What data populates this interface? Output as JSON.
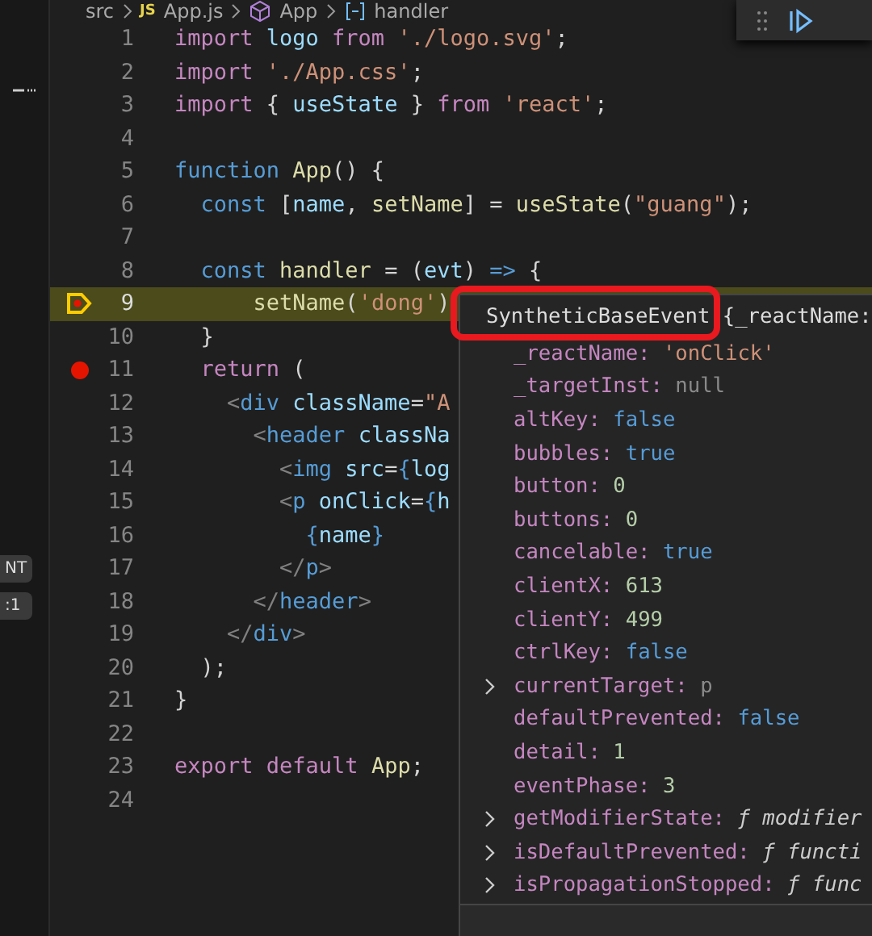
{
  "breadcrumbs": [
    {
      "label": "src",
      "kind": "folder"
    },
    {
      "label": "App.js",
      "kind": "file",
      "badge": "JS"
    },
    {
      "label": "App",
      "kind": "component"
    },
    {
      "label": "handler",
      "kind": "function"
    }
  ],
  "sidebar": {
    "badges": [
      "NT",
      ":1"
    ]
  },
  "lines": [
    {
      "number": "1",
      "highlighted": false,
      "tokens": [
        {
          "text": "import ",
          "kind": "keyword"
        },
        {
          "text": "logo ",
          "kind": "variable"
        },
        {
          "text": "from ",
          "kind": "keyword"
        },
        {
          "text": "'./logo.svg'",
          "kind": "string"
        },
        {
          "text": ";",
          "kind": "plain"
        }
      ]
    },
    {
      "number": "2",
      "highlighted": false,
      "tokens": [
        {
          "text": "import ",
          "kind": "keyword"
        },
        {
          "text": "'./App.css'",
          "kind": "string"
        },
        {
          "text": ";",
          "kind": "plain"
        }
      ]
    },
    {
      "number": "3",
      "highlighted": false,
      "tokens": [
        {
          "text": "import ",
          "kind": "keyword"
        },
        {
          "text": "{ ",
          "kind": "plain"
        },
        {
          "text": "useState",
          "kind": "variable"
        },
        {
          "text": " } ",
          "kind": "plain"
        },
        {
          "text": "from ",
          "kind": "keyword"
        },
        {
          "text": "'react'",
          "kind": "string"
        },
        {
          "text": ";",
          "kind": "plain"
        }
      ]
    },
    {
      "number": "4",
      "highlighted": false
    },
    {
      "number": "5",
      "highlighted": false,
      "tokens": [
        {
          "text": "function ",
          "kind": "storage"
        },
        {
          "text": "App",
          "kind": "function"
        },
        {
          "text": "() {",
          "kind": "plain"
        }
      ]
    },
    {
      "number": "6",
      "highlighted": false,
      "tokens": [
        {
          "text": "  const ",
          "kind": "storage"
        },
        {
          "text": "[",
          "kind": "plain"
        },
        {
          "text": "name",
          "kind": "variable"
        },
        {
          "text": ", ",
          "kind": "plain"
        },
        {
          "text": "setName",
          "kind": "function"
        },
        {
          "text": "] = ",
          "kind": "plain"
        },
        {
          "text": "useState",
          "kind": "function"
        },
        {
          "text": "(",
          "kind": "plain"
        },
        {
          "text": "\"guang\"",
          "kind": "string"
        },
        {
          "text": ");",
          "kind": "plain"
        }
      ]
    },
    {
      "number": "7",
      "highlighted": false
    },
    {
      "number": "8",
      "highlighted": false,
      "tokens": [
        {
          "text": "  const ",
          "kind": "storage"
        },
        {
          "text": "handler",
          "kind": "function"
        },
        {
          "text": " = (",
          "kind": "plain"
        },
        {
          "text": "evt",
          "kind": "variable"
        },
        {
          "text": ") ",
          "kind": "plain"
        },
        {
          "text": "=>",
          "kind": "storage"
        },
        {
          "text": " {",
          "kind": "plain"
        }
      ]
    },
    {
      "number": "9",
      "breakpoint": true,
      "paused": true,
      "highlighted": true,
      "tokens": [
        {
          "text": "      setName",
          "kind": "function"
        },
        {
          "text": "(",
          "kind": "plain"
        },
        {
          "text": "'dong'",
          "kind": "string"
        },
        {
          "text": ")",
          "kind": "plain"
        }
      ]
    },
    {
      "number": "10",
      "highlighted": false,
      "tokens": [
        {
          "text": "  }",
          "kind": "plain"
        }
      ]
    },
    {
      "number": "11",
      "breakpoint": true,
      "paused": false,
      "highlighted": false,
      "tokens": [
        {
          "text": "  return ",
          "kind": "keyword"
        },
        {
          "text": "(",
          "kind": "plain"
        }
      ]
    },
    {
      "number": "12",
      "highlighted": false,
      "tokens": [
        {
          "text": "    <",
          "kind": "tag"
        },
        {
          "text": "div ",
          "kind": "storage"
        },
        {
          "text": "className",
          "kind": "variable"
        },
        {
          "text": "=",
          "kind": "plain"
        },
        {
          "text": "\"A",
          "kind": "string"
        }
      ]
    },
    {
      "number": "13",
      "highlighted": false,
      "tokens": [
        {
          "text": "      <",
          "kind": "tag"
        },
        {
          "text": "header ",
          "kind": "storage"
        },
        {
          "text": "classNa",
          "kind": "variable"
        }
      ]
    },
    {
      "number": "14",
      "highlighted": false,
      "tokens": [
        {
          "text": "        <",
          "kind": "tag"
        },
        {
          "text": "img ",
          "kind": "storage"
        },
        {
          "text": "src",
          "kind": "variable"
        },
        {
          "text": "=",
          "kind": "plain"
        },
        {
          "text": "{",
          "kind": "storage"
        },
        {
          "text": "log",
          "kind": "variable"
        }
      ]
    },
    {
      "number": "15",
      "highlighted": false,
      "tokens": [
        {
          "text": "        <",
          "kind": "tag"
        },
        {
          "text": "p ",
          "kind": "storage"
        },
        {
          "text": "onClick",
          "kind": "variable"
        },
        {
          "text": "=",
          "kind": "plain"
        },
        {
          "text": "{",
          "kind": "storage"
        },
        {
          "text": "h",
          "kind": "variable"
        }
      ]
    },
    {
      "number": "16",
      "highlighted": false,
      "tokens": [
        {
          "text": "          {",
          "kind": "storage"
        },
        {
          "text": "name",
          "kind": "variable"
        },
        {
          "text": "}",
          "kind": "storage"
        }
      ]
    },
    {
      "number": "17",
      "highlighted": false,
      "tokens": [
        {
          "text": "        </",
          "kind": "tag"
        },
        {
          "text": "p",
          "kind": "storage"
        },
        {
          "text": ">",
          "kind": "tag"
        }
      ]
    },
    {
      "number": "18",
      "highlighted": false,
      "tokens": [
        {
          "text": "      </",
          "kind": "tag"
        },
        {
          "text": "header",
          "kind": "storage"
        },
        {
          "text": ">",
          "kind": "tag"
        }
      ]
    },
    {
      "number": "19",
      "highlighted": false,
      "tokens": [
        {
          "text": "    </",
          "kind": "tag"
        },
        {
          "text": "div",
          "kind": "storage"
        },
        {
          "text": ">",
          "kind": "tag"
        }
      ]
    },
    {
      "number": "20",
      "highlighted": false,
      "tokens": [
        {
          "text": "  );",
          "kind": "plain"
        }
      ]
    },
    {
      "number": "21",
      "highlighted": false,
      "tokens": [
        {
          "text": "}",
          "kind": "plain"
        }
      ]
    },
    {
      "number": "22",
      "highlighted": false
    },
    {
      "number": "23",
      "highlighted": false,
      "tokens": [
        {
          "text": "export ",
          "kind": "keyword"
        },
        {
          "text": "default ",
          "kind": "keyword"
        },
        {
          "text": "App",
          "kind": "function"
        },
        {
          "text": ";",
          "kind": "plain"
        }
      ]
    },
    {
      "number": "24",
      "highlighted": false
    }
  ],
  "hover": {
    "header": "SyntheticBaseEvent {_reactName:",
    "properties": [
      {
        "name": "_reactName:",
        "value": "'onClick'",
        "kind": "string",
        "expandable": false
      },
      {
        "name": "_targetInst:",
        "value": "null",
        "kind": "null",
        "expandable": false
      },
      {
        "name": "altKey:",
        "value": "false",
        "kind": "boolean",
        "expandable": false
      },
      {
        "name": "bubbles:",
        "value": "true",
        "kind": "boolean",
        "expandable": false
      },
      {
        "name": "button:",
        "value": "0",
        "kind": "number",
        "expandable": false
      },
      {
        "name": "buttons:",
        "value": "0",
        "kind": "number",
        "expandable": false
      },
      {
        "name": "cancelable:",
        "value": "true",
        "kind": "boolean",
        "expandable": false
      },
      {
        "name": "clientX:",
        "value": "613",
        "kind": "number",
        "expandable": false
      },
      {
        "name": "clientY:",
        "value": "499",
        "kind": "number",
        "expandable": false
      },
      {
        "name": "ctrlKey:",
        "value": "false",
        "kind": "boolean",
        "expandable": false
      },
      {
        "name": "currentTarget:",
        "value": "p",
        "kind": "null",
        "expandable": true
      },
      {
        "name": "defaultPrevented:",
        "value": "false",
        "kind": "boolean",
        "expandable": false
      },
      {
        "name": "detail:",
        "value": "1",
        "kind": "number",
        "expandable": false
      },
      {
        "name": "eventPhase:",
        "value": "3",
        "kind": "number",
        "expandable": false
      },
      {
        "name": "getModifierState:",
        "value": "ƒ modifier",
        "kind": "function",
        "expandable": true
      },
      {
        "name": "isDefaultPrevented:",
        "value": "ƒ functi",
        "kind": "function",
        "expandable": true
      },
      {
        "name": "isPropagationStopped:",
        "value": "ƒ func",
        "kind": "function",
        "expandable": true
      }
    ]
  }
}
